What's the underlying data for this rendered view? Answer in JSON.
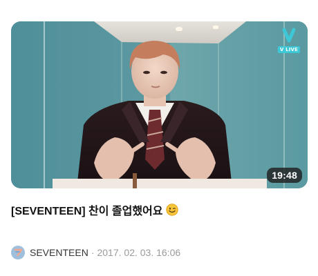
{
  "video": {
    "duration": "19:48",
    "badge_label": "V LIVE",
    "title": "[SEVENTEEN] 찬이 졸업했어요",
    "title_emoji": "winking-smile-emoji",
    "channel": "SEVENTEEN",
    "separator": "·",
    "date": "2017. 02. 03. 16:06"
  },
  "colors": {
    "badge_accent": "#3ec7d6",
    "duration_bg": "#202020",
    "title_text": "#111111",
    "date_text": "#9a9a9a"
  }
}
